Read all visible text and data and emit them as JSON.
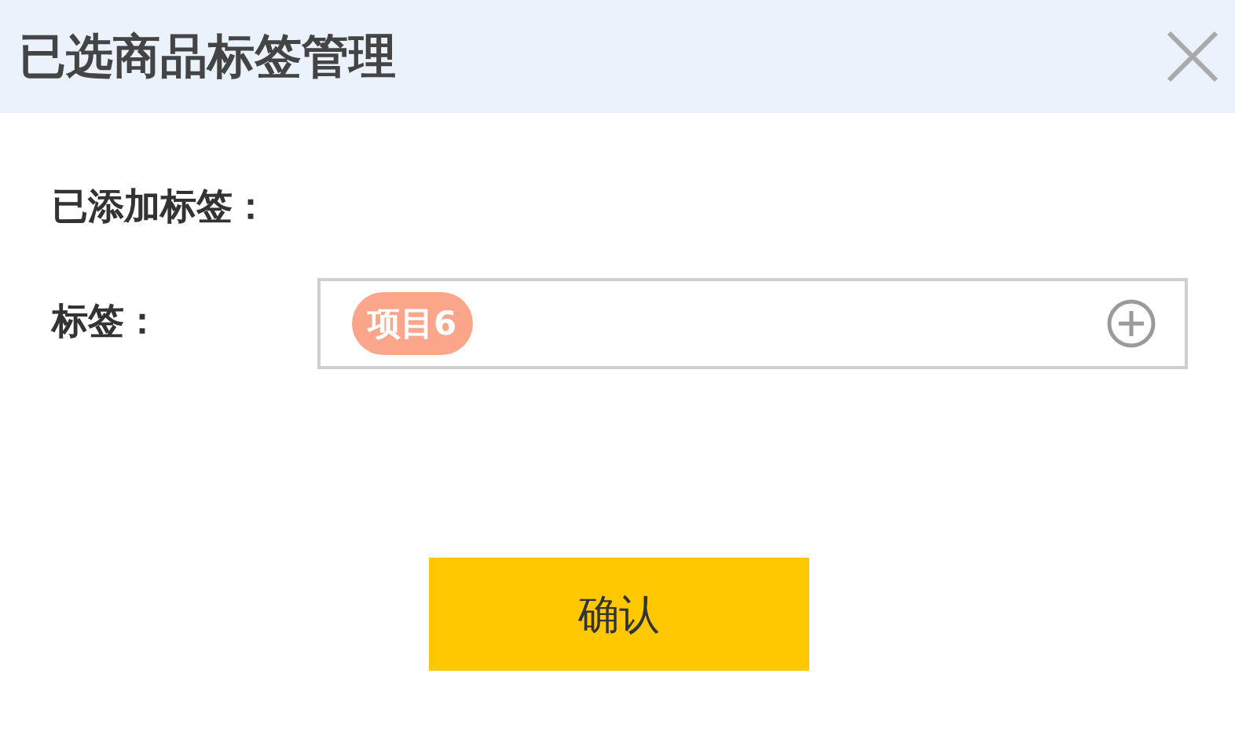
{
  "dialog": {
    "title": "已选商品标签管理"
  },
  "added_tags": {
    "label": "已添加标签："
  },
  "tag_field": {
    "label": "标签：",
    "tags": [
      {
        "text": "项目6",
        "color": "#fba58b"
      }
    ]
  },
  "buttons": [
    {
      "label": "确认"
    }
  ]
}
